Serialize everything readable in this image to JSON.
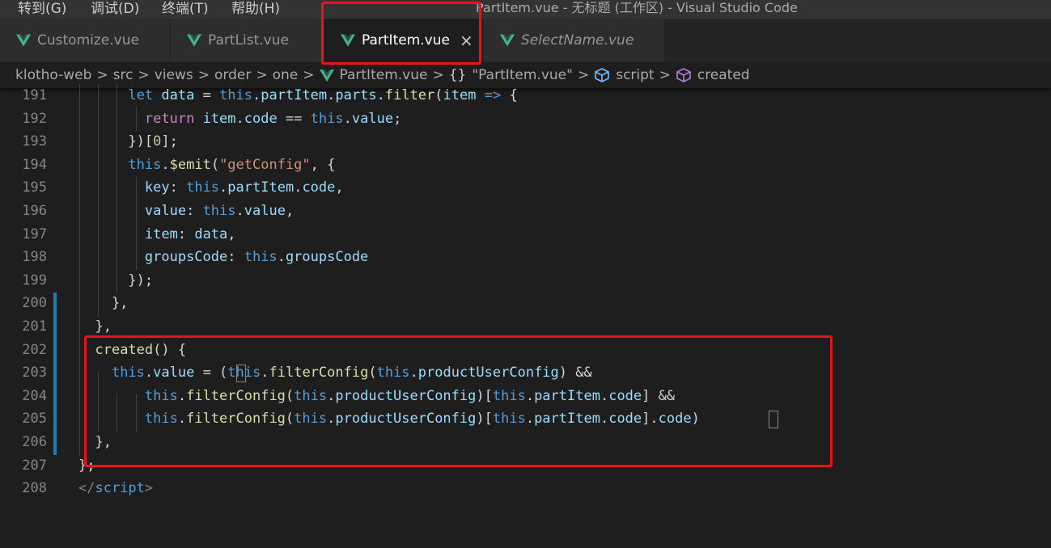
{
  "menu": {
    "items": [
      "转到(G)",
      "调试(D)",
      "终端(T)",
      "帮助(H)"
    ],
    "window_title": "PartItem.vue - 无标题 (工作区) - Visual Studio Code"
  },
  "tabs": [
    {
      "label": "Customize.vue",
      "icon": "vue-icon",
      "active": false,
      "italic": false
    },
    {
      "label": "PartList.vue",
      "icon": "vue-icon",
      "active": false,
      "italic": false
    },
    {
      "label": "PartItem.vue",
      "icon": "vue-icon",
      "active": true,
      "italic": false,
      "close": "×"
    },
    {
      "label": "SelectName.vue",
      "icon": "vue-icon",
      "active": false,
      "italic": true
    }
  ],
  "breadcrumb": {
    "items": [
      "klotho-web",
      "src",
      "views",
      "order",
      "one",
      "PartItem.vue",
      "\"PartItem.vue\"",
      "script",
      "created"
    ],
    "separator": ">",
    "braces": "{}"
  },
  "editor": {
    "lines": [
      {
        "number": "191"
      },
      {
        "number": "192"
      },
      {
        "number": "193"
      },
      {
        "number": "194"
      },
      {
        "number": "195"
      },
      {
        "number": "196"
      },
      {
        "number": "197"
      },
      {
        "number": "198"
      },
      {
        "number": "199"
      },
      {
        "number": "200"
      },
      {
        "number": "201"
      },
      {
        "number": "202"
      },
      {
        "number": "203"
      },
      {
        "number": "204"
      },
      {
        "number": "205"
      },
      {
        "number": "206"
      },
      {
        "number": "207"
      },
      {
        "number": "208"
      }
    ]
  },
  "colors": {
    "accent_vue": "#41b883",
    "annotation_red": "#e8141a",
    "gutter_modified": "#1b81a8",
    "keyword": "#569cd6",
    "variable": "#9cdcfe",
    "function": "#dcdcaa",
    "string": "#ce9178"
  }
}
